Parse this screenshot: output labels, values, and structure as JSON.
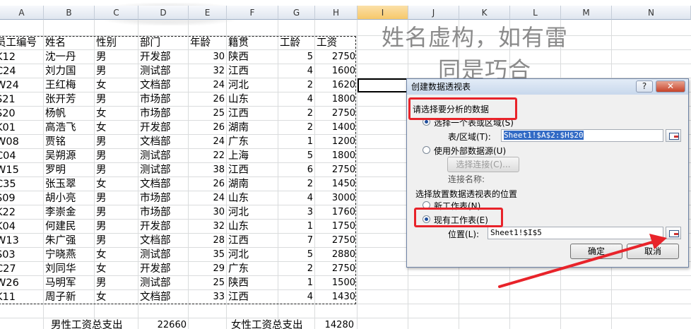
{
  "columns": [
    "A",
    "B",
    "C",
    "D",
    "E",
    "F",
    "G",
    "H",
    "I",
    "J",
    "K",
    "L",
    "M",
    "N"
  ],
  "selected_column": "I",
  "headers": [
    "员工编号",
    "姓名",
    "性别",
    "部门",
    "年龄",
    "籍贯",
    "工龄",
    "工资"
  ],
  "rows": [
    [
      "K12",
      "沈一丹",
      "男",
      "开发部",
      "30",
      "陕西",
      "5",
      "2750"
    ],
    [
      "C24",
      "刘力国",
      "男",
      "测试部",
      "32",
      "江西",
      "4",
      "1600"
    ],
    [
      "W24",
      "王红梅",
      "女",
      "文档部",
      "24",
      "河北",
      "2",
      "1620"
    ],
    [
      "S21",
      "张开芳",
      "男",
      "市场部",
      "26",
      "山东",
      "4",
      "1800"
    ],
    [
      "S20",
      "杨帆",
      "女",
      "市场部",
      "25",
      "江西",
      "2",
      "2750"
    ],
    [
      "K01",
      "高浩飞",
      "女",
      "开发部",
      "26",
      "湖南",
      "2",
      "1400"
    ],
    [
      "W08",
      "贾铭",
      "男",
      "文档部",
      "24",
      "广东",
      "1",
      "1200"
    ],
    [
      "C04",
      "吴朔源",
      "男",
      "测试部",
      "22",
      "上海",
      "5",
      "1800"
    ],
    [
      "W15",
      "罗明",
      "男",
      "测试部",
      "38",
      "江西",
      "6",
      "2750"
    ],
    [
      "C35",
      "张玉翠",
      "女",
      "文档部",
      "26",
      "湖南",
      "2",
      "1450"
    ],
    [
      "S09",
      "胡小亮",
      "男",
      "市场部",
      "24",
      "山东",
      "4",
      "3000"
    ],
    [
      "K22",
      "李崇金",
      "男",
      "市场部",
      "30",
      "河北",
      "3",
      "1760"
    ],
    [
      "K04",
      "何建民",
      "男",
      "开发部",
      "32",
      "山东",
      "1",
      "1750"
    ],
    [
      "W13",
      "朱广强",
      "男",
      "文档部",
      "28",
      "江西",
      "7",
      "2750"
    ],
    [
      "S03",
      "宁晓燕",
      "女",
      "测试部",
      "35",
      "河北",
      "5",
      "2880"
    ],
    [
      "C27",
      "刘同华",
      "女",
      "开发部",
      "29",
      "广东",
      "2",
      "2750"
    ],
    [
      "W26",
      "马明军",
      "男",
      "测试部",
      "25",
      "陕西",
      "1",
      "1500"
    ],
    [
      "K11",
      "周子新",
      "女",
      "文档部",
      "33",
      "江西",
      "4",
      "1430"
    ]
  ],
  "summary": {
    "male_label": "男性工资总支出",
    "male_value": "22660",
    "female_label": "女性工资总支出",
    "female_value": "14280"
  },
  "watermark": {
    "line1": "姓名虚构，如有雷",
    "line2": "同是巧合"
  },
  "dialog": {
    "title": "创建数据透视表",
    "help": "?",
    "close": "✕",
    "section1": "请选择要分析的数据",
    "opt_range": "选择一个表或区域(S)",
    "range_label": "表/区域(T):",
    "range_value": "Sheet1!$A$2:$H$20",
    "opt_external": "使用外部数据源(U)",
    "choose_conn": "选择连接(C)...",
    "conn_name_label": "连接名称:",
    "section2": "选择放置数据透视表的位置",
    "opt_new_sheet": "新工作表(N)",
    "opt_existing_sheet": "现有工作表(E)",
    "location_label": "位置(L):",
    "location_value": "Sheet1!$I$5",
    "ok": "确定",
    "cancel": "取消"
  },
  "colors": {
    "highlight": "#e8232a",
    "selection": "#316ac5"
  }
}
